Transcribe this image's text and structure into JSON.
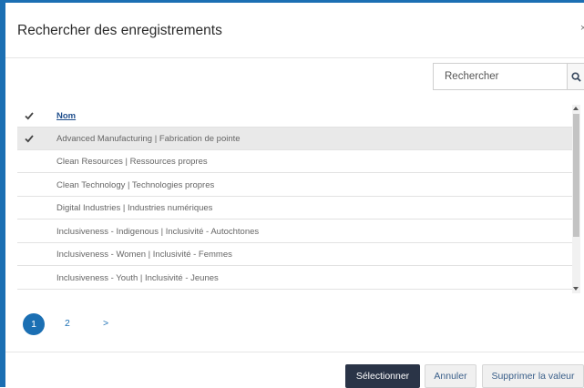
{
  "dialog": {
    "title": "Rechercher des enregistrements",
    "close_label": "×"
  },
  "search": {
    "placeholder": "Rechercher",
    "icon": "search-icon"
  },
  "table": {
    "header": {
      "check": "✔",
      "column": "Nom"
    },
    "rows": [
      {
        "label": "Advanced Manufacturing | Fabrication de pointe",
        "selected": true
      },
      {
        "label": "Clean Resources | Ressources propres",
        "selected": false
      },
      {
        "label": "Clean Technology | Technologies propres",
        "selected": false
      },
      {
        "label": "Digital Industries | Industries numériques",
        "selected": false
      },
      {
        "label": "Inclusiveness - Indigenous | Inclusivité - Autochtones",
        "selected": false
      },
      {
        "label": "Inclusiveness - Women | Inclusivité - Femmes",
        "selected": false
      },
      {
        "label": "Inclusiveness - Youth | Inclusivité - Jeunes",
        "selected": false
      }
    ]
  },
  "pagination": {
    "current": "1",
    "next_page": "2",
    "next_arrow": ">"
  },
  "footer": {
    "select_label": "Sélectionner",
    "cancel_label": "Annuler",
    "clear_label": "Supprimer la valeur"
  },
  "colors": {
    "accent": "#1b6fb3",
    "primary_button": "#2a3447",
    "selected_row": "#e9e9e9"
  }
}
